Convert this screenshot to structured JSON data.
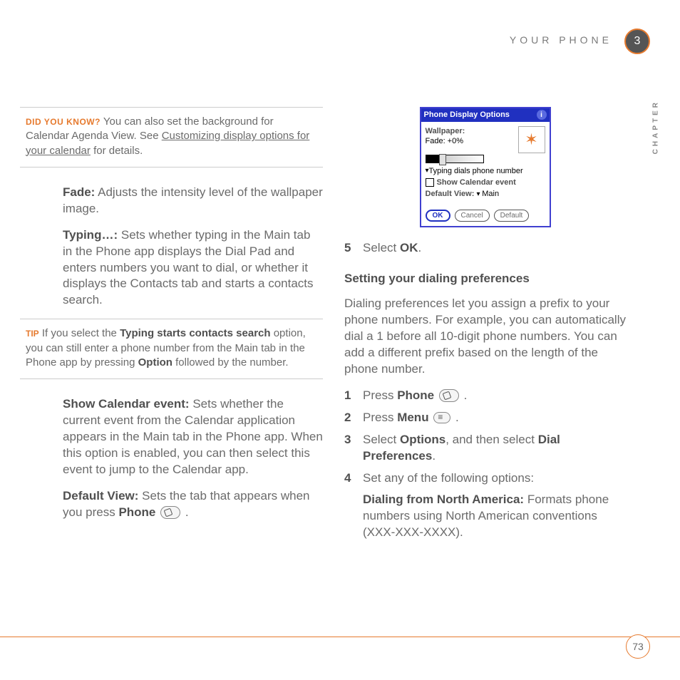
{
  "header": {
    "section_title": "YOUR PHONE",
    "chapter_num": "3",
    "chapter_label": "CHAPTER"
  },
  "left": {
    "callout1": {
      "tag": "DID YOU KNOW?",
      "text_a": "You can also set the background for Calendar Agenda View. See ",
      "link": "Customizing display options for your calendar",
      "text_b": " for details."
    },
    "fade_label": "Fade:",
    "fade_text": " Adjusts the intensity level of the wallpaper image.",
    "typing_label": "Typing…:",
    "typing_text": " Sets whether typing in the Main tab in the Phone app displays the Dial Pad and enters numbers you want to dial, or whether it displays the Contacts tab and starts a contacts search.",
    "callout2": {
      "tag": "TIP",
      "text_a": "If you select the ",
      "bold_a": "Typing starts contacts search",
      "text_b": " option, you can still enter a phone number from the Main tab in the Phone app by pressing ",
      "bold_b": "Option",
      "text_c": " followed by the number."
    },
    "show_label": "Show Calendar event:",
    "show_text": " Sets whether the current event from the Calendar application appears in the Main tab in the Phone app. When this option is enabled, you can then select this event to jump to the Calendar app.",
    "default_label": "Default View:",
    "default_text_a": " Sets the tab that appears when you press ",
    "default_bold": "Phone",
    "default_text_b": " ."
  },
  "right": {
    "palm": {
      "title": "Phone Display Options",
      "wallpaper": "Wallpaper:",
      "fade": "Fade:   +0%",
      "typing": "Typing dials phone number",
      "show_event": "Show Calendar event",
      "default_view_label": "Default View:",
      "default_view_value": "Main",
      "ok": "OK",
      "cancel": "Cancel",
      "default": "Default"
    },
    "step5_num": "5",
    "step5_a": "Select ",
    "step5_bold": "OK",
    "step5_b": ".",
    "subhead": "Setting your dialing preferences",
    "intro": "Dialing preferences let you assign a prefix to your phone numbers. For example, you can automatically dial a 1 before all 10-digit phone numbers. You can add a different prefix based on the length of the phone number.",
    "s1_num": "1",
    "s1_a": "Press ",
    "s1_bold": "Phone",
    "s1_b": " .",
    "s2_num": "2",
    "s2_a": "Press ",
    "s2_bold": "Menu",
    "s2_b": " .",
    "s3_num": "3",
    "s3_a": "Select ",
    "s3_bold_a": "Options",
    "s3_mid": ", and then select ",
    "s3_bold_b": "Dial Preferences",
    "s3_end": ".",
    "s4_num": "4",
    "s4_text": "Set any of the following options:",
    "dfna_label": "Dialing from North America:",
    "dfna_text": " Formats phone numbers using North American conventions (XXX-XXX-XXXX)."
  },
  "footer": {
    "page_number": "73"
  }
}
